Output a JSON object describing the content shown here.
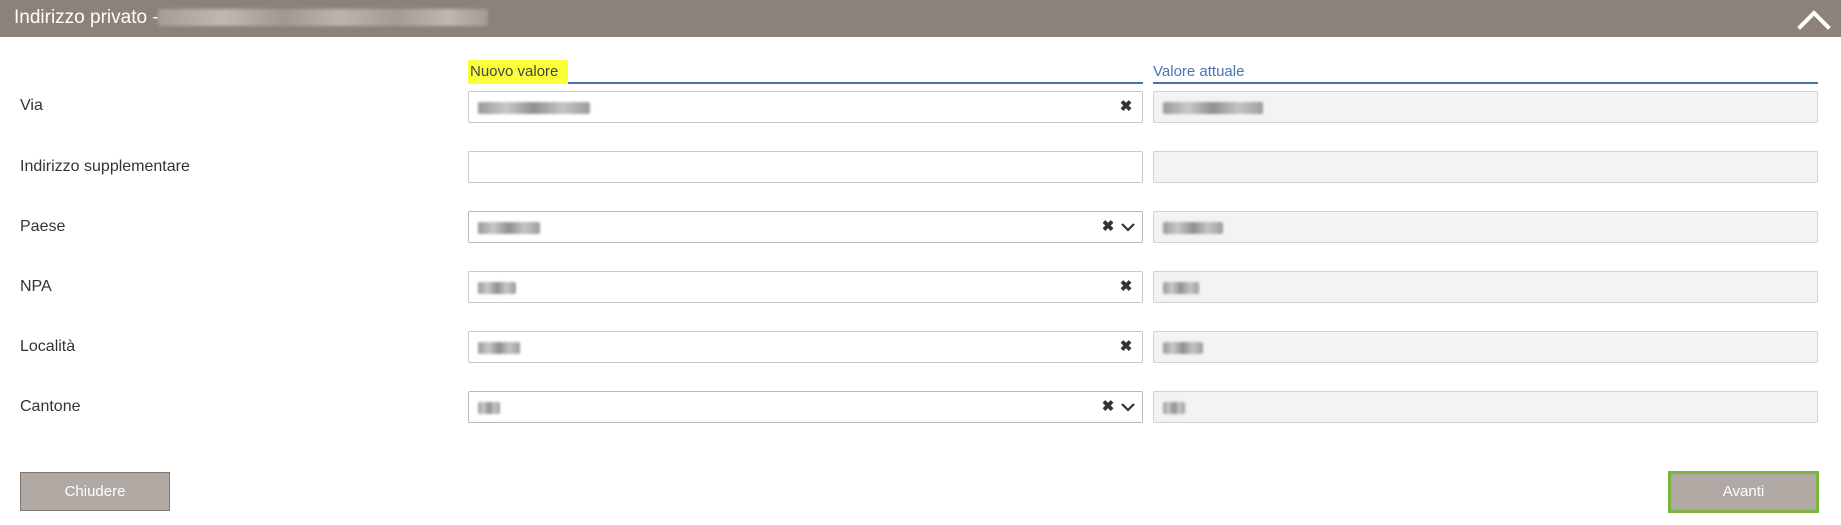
{
  "header": {
    "title": "Indirizzo privato -",
    "collapse_icon": "chevron-up-icon"
  },
  "columns": {
    "new_value": "Nuovo valore",
    "current_value": "Valore attuale"
  },
  "rows": [
    {
      "label": "Via",
      "new_value": "",
      "current_value": "",
      "type": "text",
      "clearable": true
    },
    {
      "label": "Indirizzo supplementare",
      "new_value": "",
      "current_value": "",
      "type": "text",
      "clearable": false
    },
    {
      "label": "Paese",
      "new_value": "",
      "current_value": "",
      "type": "select",
      "clearable": true
    },
    {
      "label": "NPA",
      "new_value": "",
      "current_value": "",
      "type": "text",
      "clearable": true
    },
    {
      "label": "Località",
      "new_value": "",
      "current_value": "",
      "type": "text",
      "clearable": true
    },
    {
      "label": "Cantone",
      "new_value": "",
      "current_value": "",
      "type": "select",
      "clearable": true
    }
  ],
  "buttons": {
    "close": "Chiudere",
    "next": "Avanti"
  },
  "colors": {
    "header_bg": "#8c817b",
    "accent": "#4a74b4",
    "highlight": "#fbff3a",
    "button_bg": "#b0a8a3",
    "next_border": "#7cb342"
  }
}
